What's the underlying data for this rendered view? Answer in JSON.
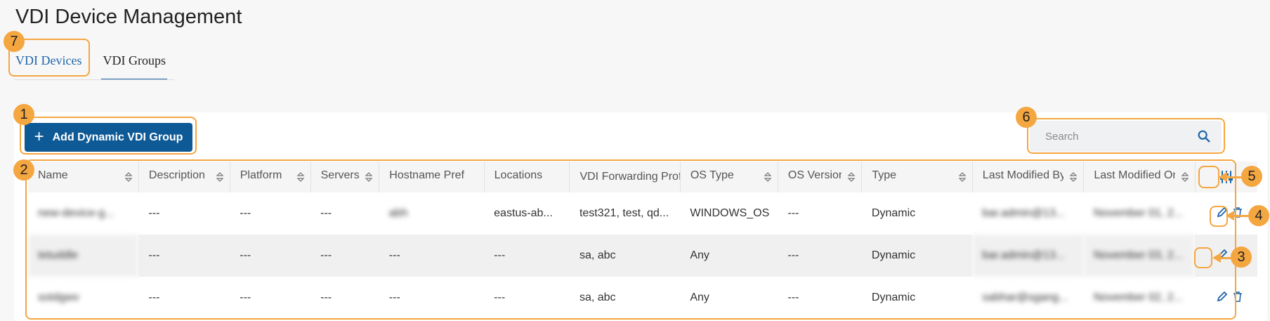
{
  "page": {
    "title": "VDI Device Management"
  },
  "tabs": [
    {
      "label": "VDI Devices",
      "active": true
    },
    {
      "label": "VDI Groups",
      "active": false
    }
  ],
  "toolbar": {
    "add_label": "Add Dynamic VDI Group",
    "add_icon": "plus-icon"
  },
  "search": {
    "placeholder": "Search",
    "icon": "search-icon"
  },
  "table": {
    "columns": [
      "Name",
      "Description",
      "Platform",
      "Servers",
      "Hostname Prefix",
      "Locations",
      "VDI Forwarding Prof",
      "OS Type",
      "OS Version",
      "Type",
      "Last Modified By",
      "Last Modified On"
    ],
    "rows": [
      [
        "new-device-g...",
        "---",
        "---",
        "---",
        "abh",
        "eastus-ab...",
        "test321, test, qd...",
        "WINDOWS_OS",
        "---",
        "Dynamic",
        "bar.admin@13...",
        "November 01, 2..."
      ],
      [
        "tetuddle",
        "---",
        "---",
        "---",
        "---",
        "---",
        "sa, abc",
        "Any",
        "---",
        "Dynamic",
        "bar.admin@13...",
        "November 03, 2..."
      ],
      [
        "sotdgwv",
        "---",
        "---",
        "---",
        "---",
        "---",
        "sa, abc",
        "Any",
        "---",
        "Dynamic",
        "sabhar@sgang...",
        "November 02, 2..."
      ]
    ]
  },
  "callouts": [
    "1",
    "2",
    "3",
    "4",
    "5",
    "6",
    "7"
  ],
  "colors": {
    "accent": "#0e5a96",
    "tab_active": "#1f64a8",
    "callout": "#f4a640"
  }
}
